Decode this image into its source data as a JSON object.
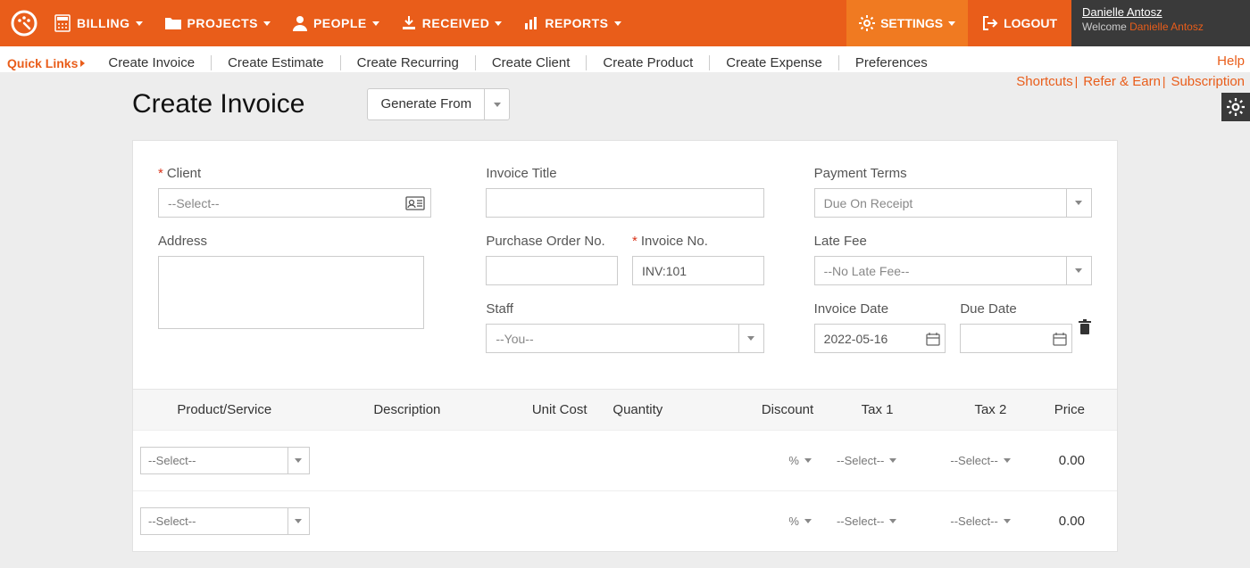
{
  "nav": {
    "items": [
      {
        "key": "billing",
        "label": "BILLING"
      },
      {
        "key": "projects",
        "label": "PROJECTS"
      },
      {
        "key": "people",
        "label": "PEOPLE"
      },
      {
        "key": "received",
        "label": "RECEIVED"
      },
      {
        "key": "reports",
        "label": "REPORTS"
      }
    ],
    "settings": "SETTINGS",
    "logout": "LOGOUT"
  },
  "user": {
    "name": "Danielle Antosz",
    "welcome_prefix": "Welcome ",
    "welcome_name": "Danielle Antosz"
  },
  "quicklinks": {
    "label": "Quick Links",
    "items": [
      "Create Invoice",
      "Create Estimate",
      "Create Recurring",
      "Create Client",
      "Create Product",
      "Create Expense",
      "Preferences"
    ],
    "help": "Help",
    "shortcuts": "Shortcuts",
    "refer": "Refer & Earn",
    "subscription": "Subscription"
  },
  "page": {
    "title": "Create Invoice",
    "generate_from": "Generate From"
  },
  "form": {
    "client_label": "Client",
    "client_placeholder": "--Select--",
    "address_label": "Address",
    "invoice_title_label": "Invoice Title",
    "po_label": "Purchase Order No.",
    "invoice_no_label": "Invoice No.",
    "invoice_no_value": "INV:101",
    "staff_label": "Staff",
    "staff_value": "--You--",
    "payment_terms_label": "Payment Terms",
    "payment_terms_value": "Due On Receipt",
    "late_fee_label": "Late Fee",
    "late_fee_value": "--No Late Fee--",
    "invoice_date_label": "Invoice Date",
    "invoice_date_value": "2022-05-16",
    "due_date_label": "Due Date",
    "due_date_value": ""
  },
  "items": {
    "headers": {
      "product": "Product/Service",
      "description": "Description",
      "unit_cost": "Unit Cost",
      "quantity": "Quantity",
      "discount": "Discount",
      "tax1": "Tax 1",
      "tax2": "Tax 2",
      "price": "Price"
    },
    "select_ph": "--Select--",
    "discount_unit": "%",
    "rows": [
      {
        "price": "0.00"
      },
      {
        "price": "0.00"
      }
    ]
  },
  "colors": {
    "accent": "#e95d1a",
    "accent_light": "#f07a21",
    "dark": "#3a3a3a"
  }
}
